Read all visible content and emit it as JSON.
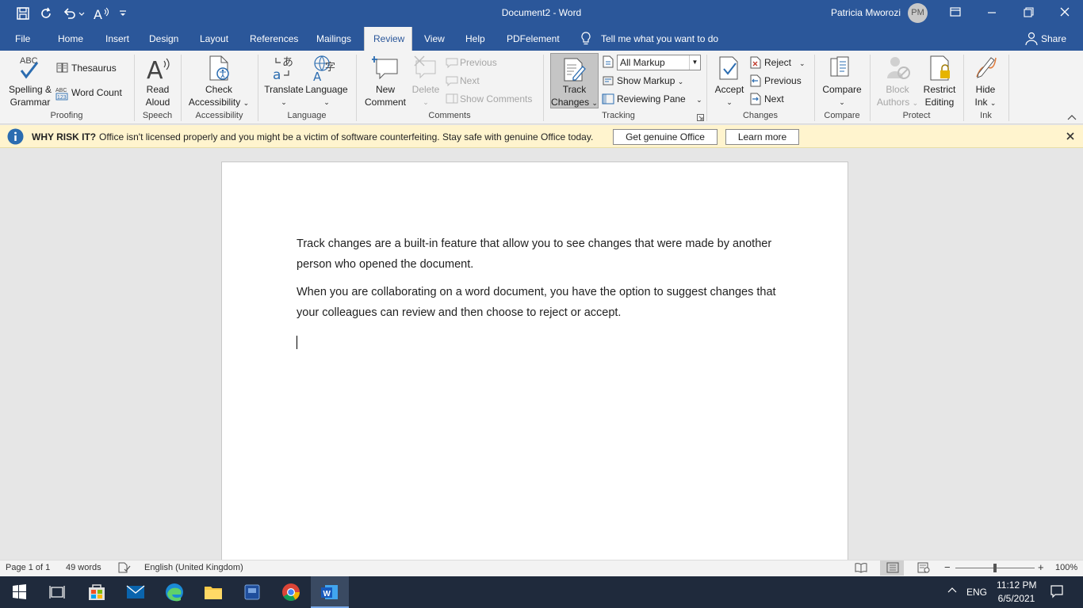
{
  "app": {
    "document_title": "Document2 - Word",
    "user_name": "Patricia Mworozi",
    "user_initials": "PM"
  },
  "tabs": [
    "File",
    "Home",
    "Insert",
    "Design",
    "Layout",
    "References",
    "Mailings",
    "Review",
    "View",
    "Help",
    "PDFelement"
  ],
  "tell_me": "Tell me what you want to do",
  "share": "Share",
  "ribbon": {
    "proofing": {
      "spelling_1": "Spelling &",
      "spelling_2": "Grammar",
      "thesaurus": "Thesaurus",
      "word_count": "Word Count",
      "group": "Proofing"
    },
    "speech": {
      "read_1": "Read",
      "read_2": "Aloud",
      "group": "Speech"
    },
    "accessibility": {
      "check_1": "Check",
      "check_2": "Accessibility",
      "group": "Accessibility"
    },
    "language": {
      "translate": "Translate",
      "language": "Language",
      "group": "Language"
    },
    "comments": {
      "new_1": "New",
      "new_2": "Comment",
      "delete": "Delete",
      "previous": "Previous",
      "next": "Next",
      "show_comments": "Show Comments",
      "group": "Comments"
    },
    "tracking": {
      "track_1": "Track",
      "track_2": "Changes",
      "markup_value": "All Markup",
      "show_markup": "Show Markup",
      "reviewing_pane": "Reviewing Pane",
      "group": "Tracking"
    },
    "changes": {
      "accept": "Accept",
      "reject": "Reject",
      "previous": "Previous",
      "next": "Next",
      "group": "Changes"
    },
    "compare": {
      "compare": "Compare",
      "group": "Compare"
    },
    "protect": {
      "block_1": "Block",
      "block_2": "Authors",
      "restrict_1": "Restrict",
      "restrict_2": "Editing",
      "group": "Protect"
    },
    "ink": {
      "hide_1": "Hide",
      "hide_2": "Ink",
      "group": "Ink"
    }
  },
  "notice": {
    "title": "WHY RISK IT?",
    "text": "Office isn't licensed properly and you might be a victim of software counterfeiting. Stay safe with genuine Office today.",
    "get_genuine": "Get genuine Office",
    "learn_more": "Learn more"
  },
  "document": {
    "paragraphs": [
      "Track changes are a built-in feature that allow you to see changes that were made by another person who opened the document.",
      "When you are collaborating on a word document, you have the option to suggest changes that your colleagues can review and then choose to reject or accept."
    ]
  },
  "status": {
    "page": "Page 1 of 1",
    "words": "49 words",
    "language": "English (United Kingdom)",
    "zoom": "100%",
    "zoom_fraction": 0.5
  },
  "taskbar": {
    "ime": "ENG",
    "time": "11:12 PM",
    "date": "6/5/2021"
  },
  "colors": {
    "word_blue": "#2b579a",
    "notice_bg": "#fff4ce",
    "taskbar": "#1f2a3c"
  }
}
